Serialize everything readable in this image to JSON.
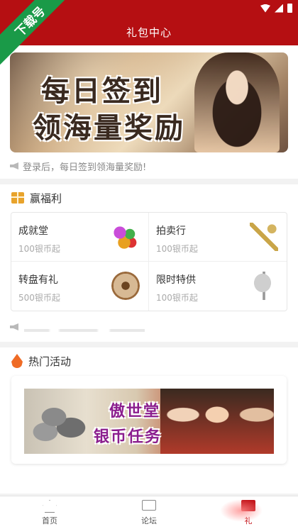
{
  "watermark": {
    "label": "下载号"
  },
  "header": {
    "title": "礼包中心"
  },
  "banner": {
    "line1": "每日签到",
    "line2": "领海量奖励",
    "notice": "登录后，每日签到领海量奖励!"
  },
  "welfare": {
    "title": "赢福利",
    "items": [
      {
        "name": "成就堂",
        "sub": "100银币起",
        "icon": "gems-icon"
      },
      {
        "name": "拍卖行",
        "sub": "100银币起",
        "icon": "key-icon"
      },
      {
        "name": "转盘有礼",
        "sub": "500银币起",
        "icon": "wheel-icon"
      },
      {
        "name": "限时特供",
        "sub": "100银币起",
        "icon": "satellite-dish-icon"
      }
    ]
  },
  "hot": {
    "title": "热门活动",
    "banner_line1": "傲世堂",
    "banner_line2": "银币任务"
  },
  "tabs": [
    {
      "label": "首页",
      "icon": "home-icon"
    },
    {
      "label": "论坛",
      "icon": "forum-icon"
    },
    {
      "label": "礼",
      "icon": "gift-icon"
    }
  ],
  "colors": {
    "brand_red": "#b50f12",
    "accent_orange": "#ef6b25",
    "watermark_green": "#1a9a48"
  }
}
